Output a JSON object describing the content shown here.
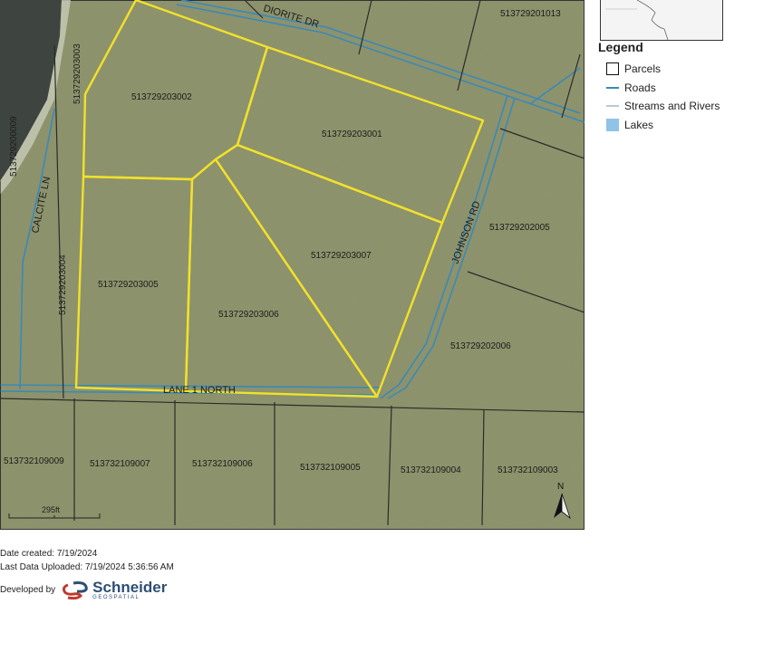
{
  "map": {
    "roads": {
      "diorite": "DIORITE DR",
      "calcite": "CALCITE LN",
      "johnson": "JOHNSON RD",
      "lane1": "LANE 1 NORTH"
    },
    "parcels": {
      "p3002": "513729203002",
      "p3001": "513729203001",
      "p3003": "513729203003",
      "p0009": "513729200009",
      "p1013": "513729201013",
      "p2005": "513729202005",
      "p3007": "513729203007",
      "p3004": "513729203004",
      "p3005": "513729203005",
      "p3006": "513729203006",
      "p2006": "513729202006",
      "b9009": "513732109009",
      "b9007": "513732109007",
      "b9006": "513732109006",
      "b9005": "513732109005",
      "b9004": "513732109004",
      "b9003": "513732109003"
    },
    "scale_label": "295ft",
    "north_label": "N"
  },
  "legend": {
    "title": "Legend",
    "items": {
      "parcels": "Parcels",
      "roads": "Roads",
      "streams": "Streams and Rivers",
      "lakes": "Lakes"
    }
  },
  "footer": {
    "date_created": "Date created: 7/19/2024",
    "last_upload": "Last Data Uploaded: 7/19/2024 5:36:56 AM",
    "developed_by": "Developed by",
    "logo_name": "Schneider",
    "logo_sub": "GEOSPATIAL"
  },
  "colors": {
    "terrain": "#8e9468",
    "parcel_highlight": "#f2e12a",
    "road": "#3a89b8",
    "parcel_line": "#2b2b2b"
  }
}
